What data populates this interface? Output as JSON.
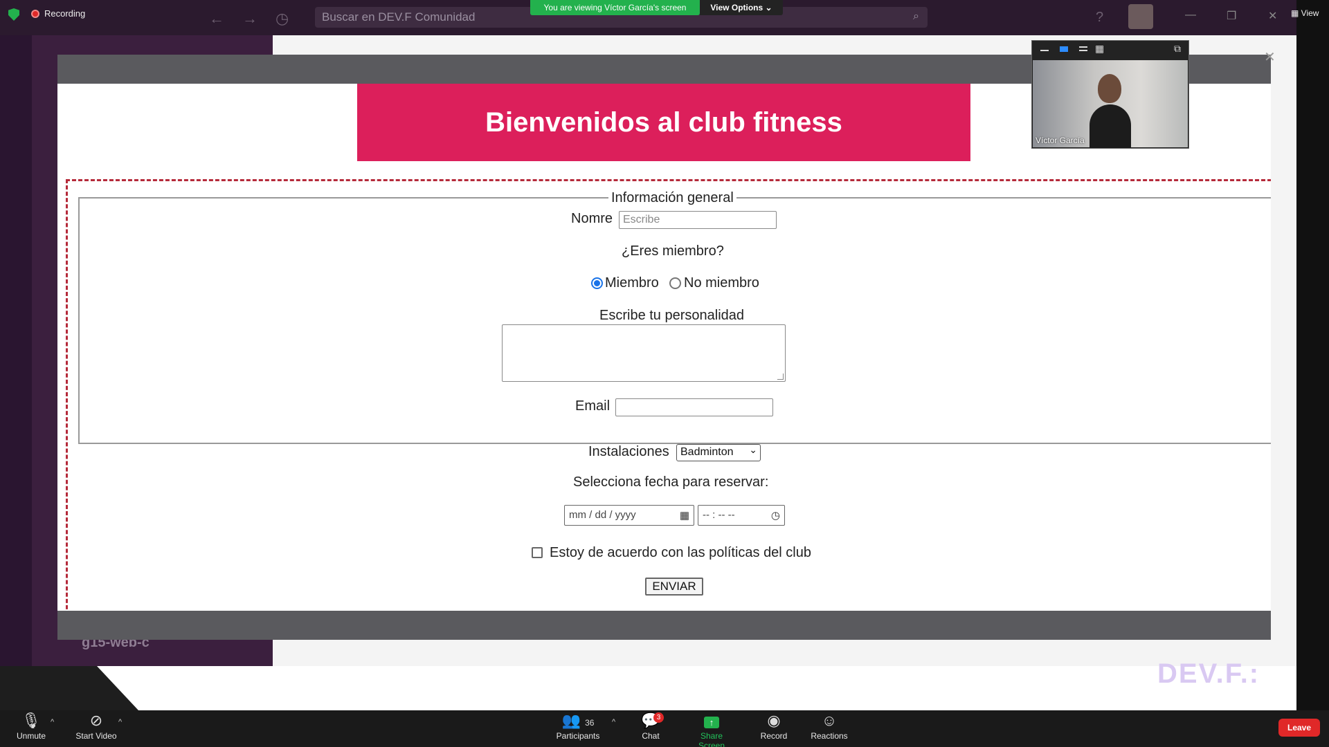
{
  "zoom": {
    "recording_label": "Recording",
    "viewing_banner": "You are viewing Víctor García's screen",
    "view_options_label": "View Options",
    "view_label": "View",
    "participants_count": "36",
    "chat_badge": "3",
    "toolbar": {
      "unmute": "Unmute",
      "start_video": "Start Video",
      "participants": "Participants",
      "chat": "Chat",
      "share_screen": "Share Screen",
      "record": "Record",
      "reactions": "Reactions",
      "leave": "Leave"
    },
    "video_tile_name": "Víctor García",
    "share_color": "#23b14d",
    "leave_color": "#e02828"
  },
  "slack": {
    "search_placeholder": "Buscar en DEV.F Comunidad",
    "channel_name": "g15-web-c",
    "logo_text": "DEV.F.:"
  },
  "page": {
    "banner_title": "Bienvenidos al club fitness",
    "banner_color": "#dc1f5b",
    "fieldset_legend": "Información general",
    "name_label": "Nomre",
    "name_placeholder": "Escribe",
    "member_question": "¿Eres miembro?",
    "radio_member": "Miembro",
    "radio_non_member": "No miembro",
    "personality_label": "Escribe tu personalidad",
    "email_label": "Email",
    "facilities_label": "Instalaciones",
    "facilities_selected": "Badminton",
    "date_label": "Selecciona fecha para reservar:",
    "date_placeholder": "mm / dd / yyyy",
    "time_placeholder": "-- : --  --",
    "agree_label": "Estoy de acuerdo con las políticas del club",
    "submit_label": "ENVIAR"
  }
}
